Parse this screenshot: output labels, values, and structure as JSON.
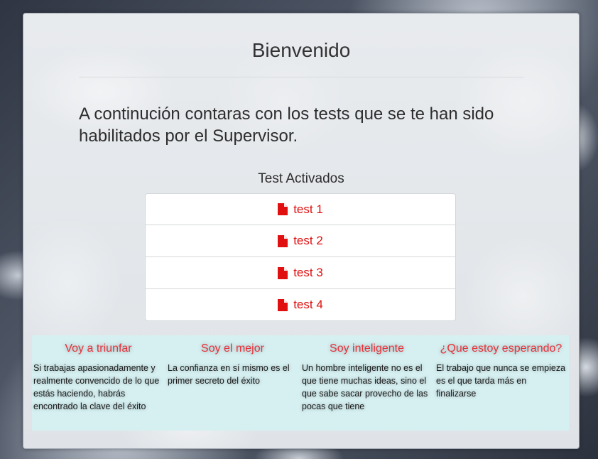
{
  "header": {
    "title": "Bienvenido"
  },
  "intro": {
    "text": "A continución contaras con los tests que se te han sido habilitados por el Supervisor."
  },
  "tests": {
    "section_title": "Test Activados",
    "items": [
      {
        "label": "test 1",
        "icon": "file-icon"
      },
      {
        "label": "test 2",
        "icon": "file-icon"
      },
      {
        "label": "test 3",
        "icon": "file-icon"
      },
      {
        "label": "test 4",
        "icon": "file-icon"
      }
    ],
    "accent_color": "#e01010"
  },
  "quotes": [
    {
      "title": "Voy a triunfar",
      "text": "Si trabajas apasionadamente y realmente convencido de lo que estás haciendo, habrás encontrado la clave del éxito"
    },
    {
      "title": "Soy el mejor",
      "text": "La confianza en sí mismo es el primer secreto del éxito"
    },
    {
      "title": "Soy inteligente",
      "text": "Un hombre inteligente no es el que tiene muchas ideas, sino el que sabe sacar provecho de las pocas que tiene"
    },
    {
      "title": "¿Que estoy esperando?",
      "text": "El trabajo que nunca se empieza es el que tarda más en finalizarse"
    }
  ],
  "colors": {
    "quote_bg": "#d6f0f2",
    "quote_title": "#e8323a"
  }
}
